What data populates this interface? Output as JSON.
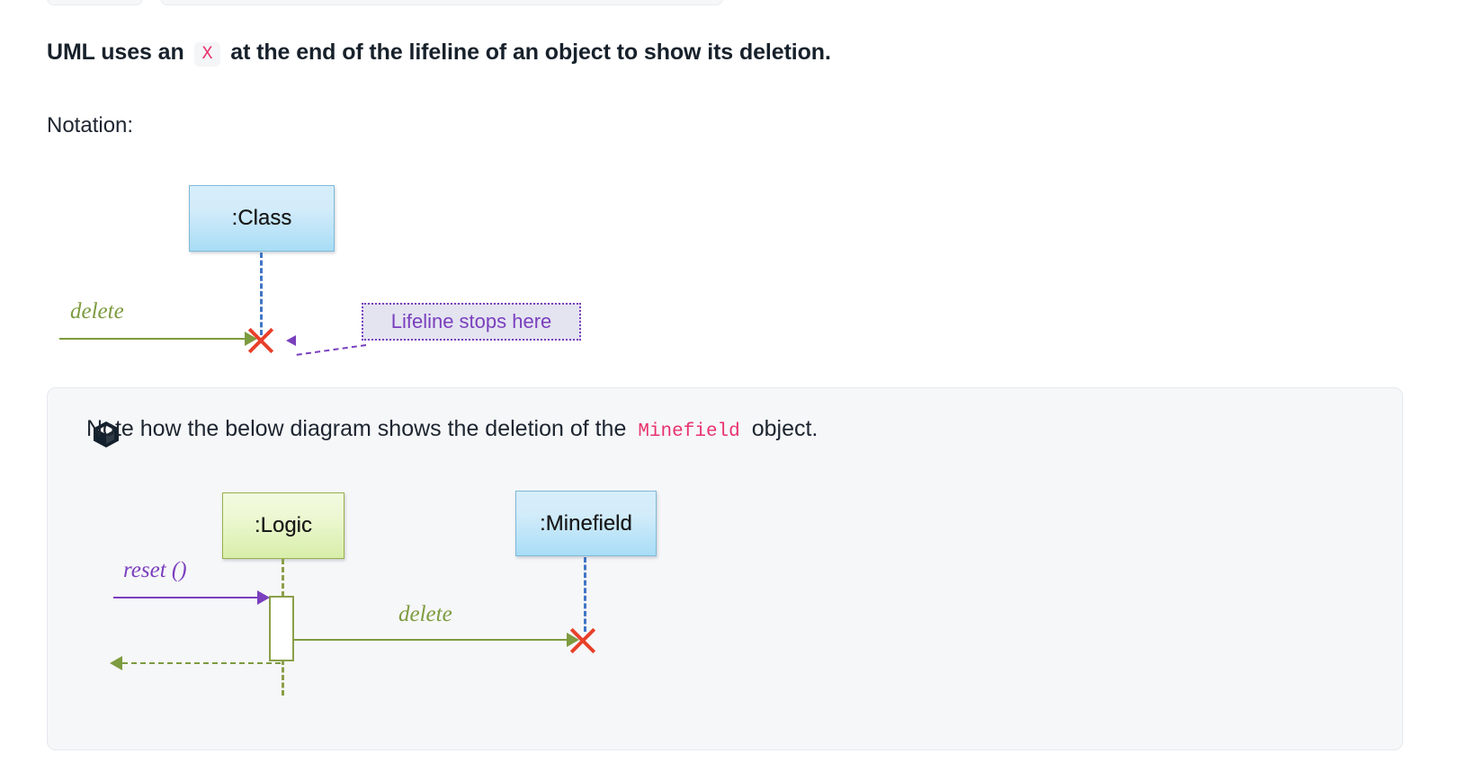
{
  "page": {
    "top_chips": [
      {
        "label": ""
      },
      {
        "label": ""
      }
    ]
  },
  "headline": {
    "before": "UML uses an",
    "code": "X",
    "after": "at the end of the lifeline of an object to show its deletion."
  },
  "notation": {
    "label": "Notation:",
    "class_box": ":Class",
    "delete_label": "delete",
    "callout": "Lifeline stops here"
  },
  "note": {
    "icon": "box-cube-icon",
    "text_before": "Note how the below diagram shows the deletion of the",
    "code": "Minefield",
    "text_after": "object.",
    "diagram": {
      "logic_box": ":Logic",
      "minefield_box": ":Minefield",
      "reset_label": "reset ()",
      "delete_label": "delete"
    }
  },
  "colors": {
    "accent_pink": "#e8336d",
    "green_message": "#7d9b3f",
    "purple_message": "#7a3fbd",
    "red_x": "#e8402a",
    "blue_lifeline": "#3f76c4",
    "olive_lifeline": "#8aa04a",
    "panel_bg": "#f6f7f9"
  }
}
